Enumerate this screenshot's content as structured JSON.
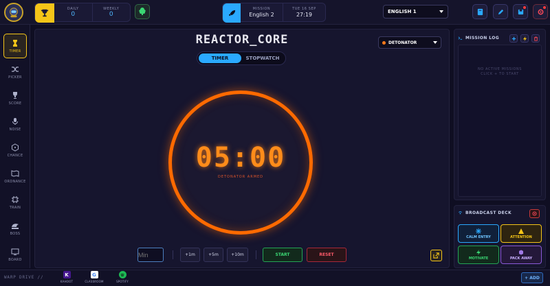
{
  "topbar": {
    "score": {
      "daily_label": "DAILY",
      "daily_value": "0",
      "weekly_label": "WEEKLY",
      "weekly_value": "0"
    },
    "mission": {
      "label": "MISSION",
      "value": "English 2",
      "date_label": "TUE 16 SEP",
      "time": "27:19"
    },
    "class_select": "ENGLISH 1"
  },
  "sidebar": {
    "items": [
      {
        "label": "TIMER",
        "icon": "hourglass-icon"
      },
      {
        "label": "PICKER",
        "icon": "shuffle-icon"
      },
      {
        "label": "SCORE",
        "icon": "trophy-icon"
      },
      {
        "label": "NOISE",
        "icon": "microphone-icon"
      },
      {
        "label": "CHANCE",
        "icon": "dice-icon"
      },
      {
        "label": "ORDNANCE",
        "icon": "map-icon"
      },
      {
        "label": "TRAIN",
        "icon": "chip-icon"
      },
      {
        "label": "BOSS",
        "icon": "boss-icon"
      },
      {
        "label": "BOARD",
        "icon": "monitor-icon"
      }
    ]
  },
  "main": {
    "title": "REACTOR_CORE",
    "mode_select": "DETONATOR",
    "toggle": {
      "timer": "TIMER",
      "stopwatch": "STOPWATCH"
    },
    "time": "05:00",
    "status": "DETONATOR ARMED",
    "controls": {
      "min_placeholder": "Min",
      "plus1": "+1m",
      "plus5": "+5m",
      "plus10": "+10m",
      "start": "START",
      "reset": "RESET"
    }
  },
  "mission_log": {
    "title": "MISSION LOG",
    "empty_line1": "NO ACTIVE MISSIONS",
    "empty_line2": "CLICK + TO START"
  },
  "broadcast": {
    "title": "BROADCAST DECK",
    "buttons": {
      "calm": "CALM ENTRY",
      "attention": "ATTENTION",
      "motivate": "MOTIVATE",
      "pack": "PACK AWAY"
    }
  },
  "dock": {
    "label": "WARP DRIVE //",
    "apps": {
      "kahoot": "KAHOOT",
      "classroom": "CLASSROOM",
      "spotify": "SPOTIFY"
    },
    "add": "+ ADD"
  },
  "colors": {
    "accent_yellow": "#f5c518",
    "accent_blue": "#2aa9ff",
    "timer_orange": "#ff6a00",
    "start_green": "#24a455",
    "reset_red": "#a8283a"
  }
}
